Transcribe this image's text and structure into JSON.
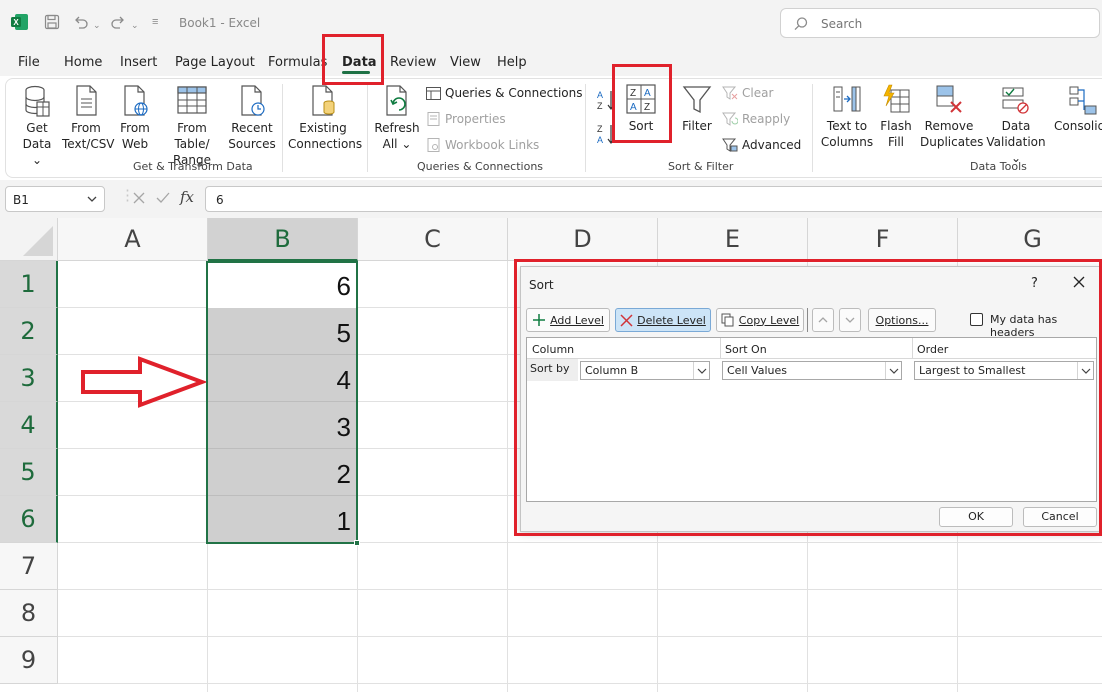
{
  "titlebar": {
    "title": "Book1  -  Excel",
    "search_placeholder": "Search"
  },
  "tabs": [
    "File",
    "Home",
    "Insert",
    "Page Layout",
    "Formulas",
    "Data",
    "Review",
    "View",
    "Help"
  ],
  "active_tab": "Data",
  "ribbon": {
    "get_transform": {
      "get_data": [
        "Get",
        "Data"
      ],
      "from_text": [
        "From",
        "Text/CSV"
      ],
      "from_web": [
        "From",
        "Web"
      ],
      "from_table": [
        "From Table/",
        "Range"
      ],
      "recent_sources": [
        "Recent",
        "Sources"
      ],
      "existing_connections": [
        "Existing",
        "Connections"
      ],
      "group_label": "Get & Transform Data"
    },
    "queries": {
      "refresh_all": [
        "Refresh",
        "All"
      ],
      "queries_connections": "Queries & Connections",
      "properties": "Properties",
      "workbook_links": "Workbook Links",
      "group_label": "Queries & Connections"
    },
    "sort_filter": {
      "sort": "Sort",
      "filter": "Filter",
      "clear": "Clear",
      "reapply": "Reapply",
      "advanced": "Advanced",
      "group_label": "Sort & Filter"
    },
    "data_tools": {
      "text_to_columns": [
        "Text to",
        "Columns"
      ],
      "flash_fill": [
        "Flash",
        "Fill"
      ],
      "remove_duplicates": [
        "Remove",
        "Duplicates"
      ],
      "data_validation": [
        "Data",
        "Validation"
      ],
      "consolidate": "Consolid",
      "group_label": "Data Tools"
    }
  },
  "formula_bar": {
    "name_box": "B1",
    "fx": "fx",
    "value": "6"
  },
  "grid": {
    "columns": [
      "A",
      "B",
      "C",
      "D",
      "E",
      "F",
      "G"
    ],
    "rows": [
      "1",
      "2",
      "3",
      "4",
      "5",
      "6",
      "7",
      "8",
      "9"
    ],
    "column_b_values": [
      "6",
      "5",
      "4",
      "3",
      "2",
      "1"
    ]
  },
  "dialog": {
    "title": "Sort",
    "help": "?",
    "add_level": "Add Level",
    "delete_level": "Delete Level",
    "copy_level": "Copy Level",
    "options": "Options...",
    "headers_checkbox": "My data has headers",
    "headers": {
      "column": "Column",
      "sort_on": "Sort On",
      "order": "Order"
    },
    "row": {
      "label": "Sort by",
      "column": "Column B",
      "sort_on": "Cell Values",
      "order": "Largest to Smallest"
    },
    "ok": "OK",
    "cancel": "Cancel"
  },
  "colors": {
    "excel_green": "#217346",
    "highlight_red": "#e0212b",
    "selection_active": "#cce4f7"
  }
}
